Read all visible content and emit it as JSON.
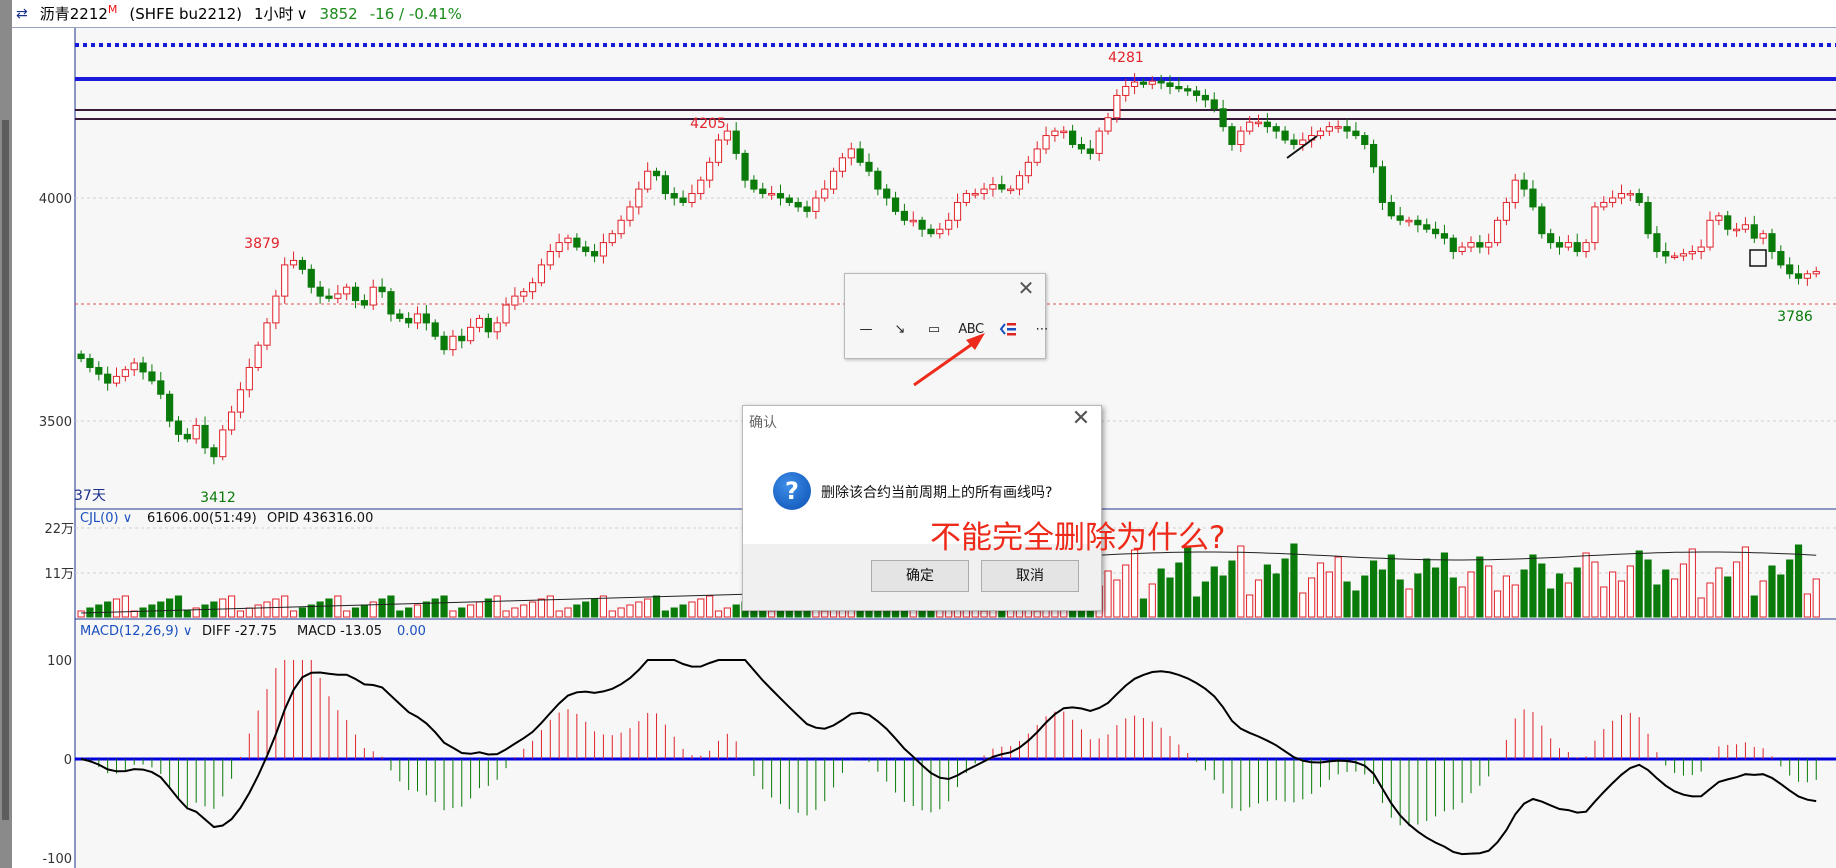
{
  "header": {
    "instrument": "沥青2212",
    "instrument_sup": "M",
    "exchange_code": "(SHFE bu2212)",
    "period": "1小时",
    "price": "3852",
    "change": "-16 / -0.41%"
  },
  "price_pane": {
    "y_ticks": [
      "4000",
      "3500"
    ],
    "high_labels": [
      "4205",
      "3879",
      "4281"
    ],
    "low_labels": [
      "3412",
      "3786"
    ],
    "days_label": "37天"
  },
  "volume_pane": {
    "indicator": "CJL(0)",
    "value": "61606.00(51:49)",
    "opid": "OPID 436316.00",
    "y_ticks": [
      "22万",
      "11万"
    ]
  },
  "macd_pane": {
    "indicator": "MACD(12,26,9)",
    "diff": "DIFF -27.75",
    "macd": "MACD -13.05",
    "extra": "0.00",
    "y_ticks": [
      "100",
      "0",
      "-100"
    ]
  },
  "drawing_toolbar": {
    "abc_label": "ABC"
  },
  "confirm_dialog": {
    "title": "确认",
    "message": "删除该合约当前周期上的所有画线吗?",
    "ok_label": "确定",
    "cancel_label": "取消"
  },
  "annotation_text": "不能完全删除为什么?",
  "colors": {
    "up": "#e0232b",
    "down": "#0a7a0a",
    "axis_blue": "#1a2f8a",
    "macd_zero": "#0000dd",
    "annotation": "#ee2b1b"
  },
  "chart_data": {
    "type": "candlestick",
    "y_ticks": [
      4000,
      3500
    ],
    "closes": [
      3640,
      3620,
      3605,
      3585,
      3600,
      3615,
      3630,
      3610,
      3590,
      3560,
      3500,
      3470,
      3460,
      3490,
      3440,
      3420,
      3480,
      3520,
      3570,
      3620,
      3670,
      3720,
      3780,
      3850,
      3860,
      3840,
      3800,
      3780,
      3775,
      3785,
      3800,
      3770,
      3760,
      3800,
      3790,
      3740,
      3730,
      3720,
      3740,
      3720,
      3690,
      3660,
      3690,
      3680,
      3710,
      3730,
      3700,
      3720,
      3760,
      3780,
      3790,
      3810,
      3850,
      3880,
      3900,
      3910,
      3890,
      3880,
      3870,
      3900,
      3920,
      3950,
      3980,
      4020,
      4060,
      4050,
      4010,
      4000,
      3990,
      4010,
      4040,
      4080,
      4130,
      4150,
      4100,
      4040,
      4020,
      4010,
      4010,
      4000,
      3990,
      3980,
      3970,
      4000,
      4020,
      4060,
      4090,
      4110,
      4080,
      4060,
      4020,
      4000,
      3970,
      3950,
      3950,
      3930,
      3920,
      3930,
      3950,
      3990,
      4010,
      4010,
      4020,
      4030,
      4020,
      4020,
      4050,
      4080,
      4110,
      4140,
      4150,
      4150,
      4120,
      4110,
      4100,
      4150,
      4180,
      4230,
      4250,
      4260,
      4255,
      4262,
      4258,
      4250,
      4245,
      4240,
      4230,
      4220,
      4200,
      4160,
      4120,
      4150,
      4170,
      4170,
      4160,
      4150,
      4130,
      4120,
      4130,
      4140,
      4150,
      4160,
      4160,
      4150,
      4140,
      4120,
      4070,
      3990,
      3960,
      3950,
      3950,
      3940,
      3930,
      3920,
      3910,
      3880,
      3890,
      3900,
      3890,
      3900,
      3950,
      3990,
      4040,
      4020,
      3980,
      3920,
      3900,
      3890,
      3900,
      3880,
      3900,
      3980,
      3990,
      4000,
      4010,
      4010,
      3990,
      3920,
      3880,
      3870,
      3870,
      3875,
      3880,
      3890,
      3950,
      3960,
      3930,
      3930,
      3940,
      3910,
      3920,
      3880,
      3850,
      3830,
      3820,
      3830,
      3835
    ],
    "volume_ma_note": "",
    "macd_hist_peak": 100
  }
}
